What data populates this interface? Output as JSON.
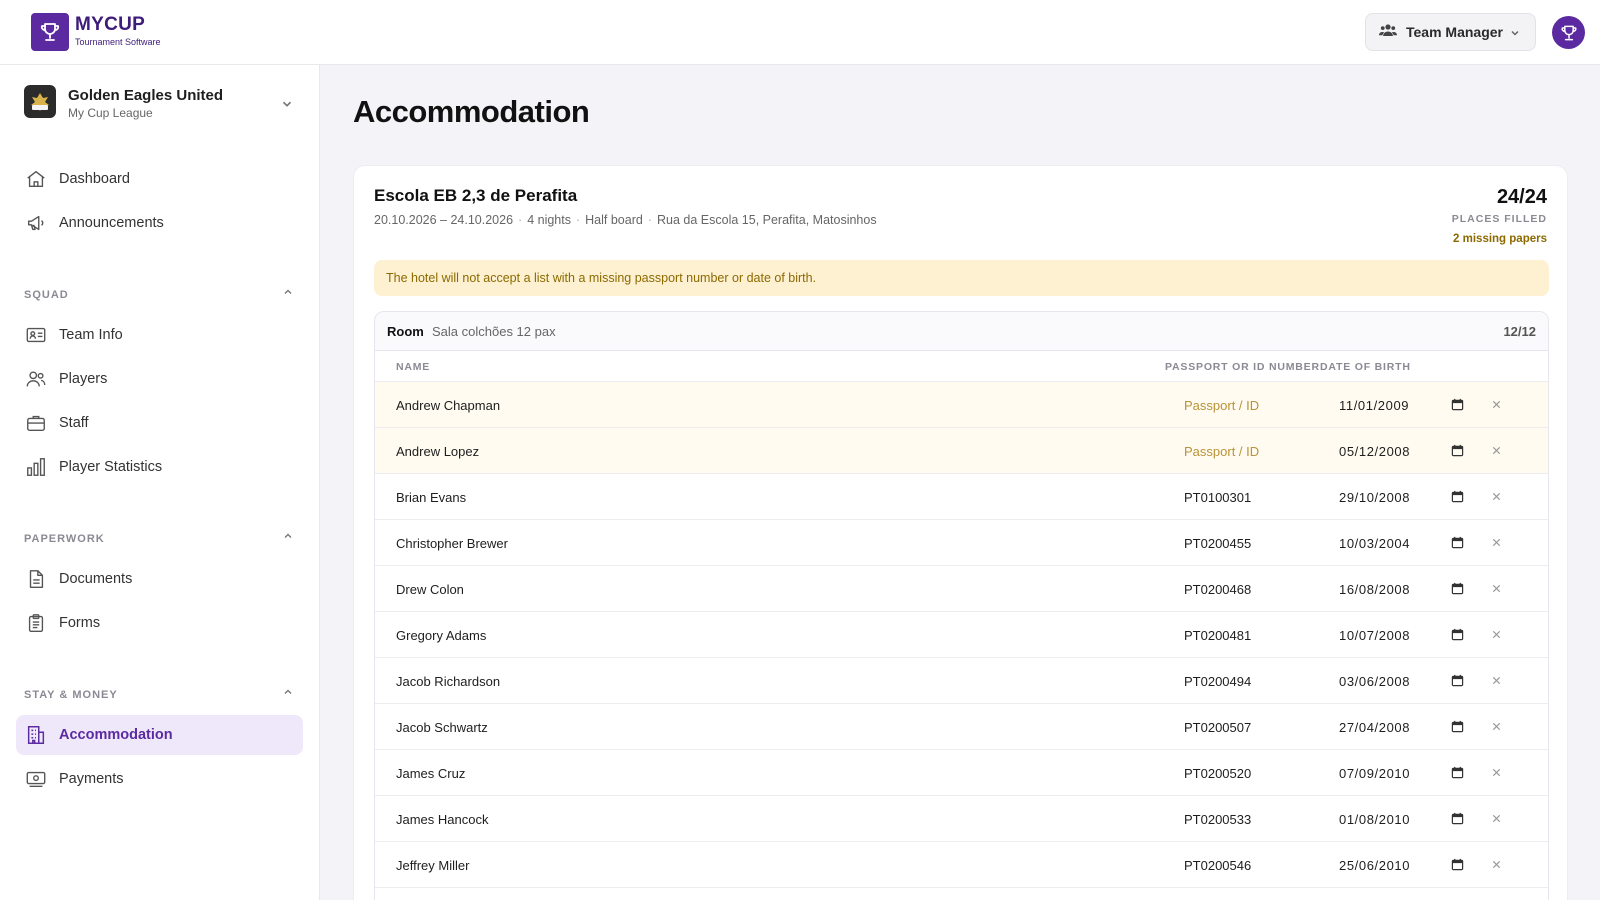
{
  "app": {
    "name": "MYCUP",
    "tagline": "Tournament Software",
    "role_label": "Team Manager"
  },
  "team": {
    "name": "Golden Eagles United",
    "league": "My Cup League"
  },
  "nav": {
    "dashboard": "Dashboard",
    "announcements": "Announcements",
    "squad_header": "SQUAD",
    "team_info": "Team Info",
    "players": "Players",
    "staff": "Staff",
    "player_statistics": "Player Statistics",
    "paperwork_header": "PAPERWORK",
    "documents": "Documents",
    "forms": "Forms",
    "stay_header": "STAY & MONEY",
    "accommodation": "Accommodation",
    "payments": "Payments"
  },
  "page": {
    "title": "Accommodation"
  },
  "venue": {
    "name": "Escola EB 2,3 de Perafita",
    "dates": "20.10.2026 – 24.10.2026",
    "nights": "4 nights",
    "board": "Half board",
    "address": "Rua da Escola 15, Perafita, Matosinhos",
    "filled": "24/24",
    "filled_label": "PLACES FILLED",
    "missing": "2 missing papers",
    "warning": "The hotel will not accept a list with a missing passport number or date of birth."
  },
  "room": {
    "label": "Room",
    "name": "Sala colchões 12 pax",
    "count": "12/12",
    "col_name": "NAME",
    "col_passport": "PASSPORT OR ID NUMBER",
    "col_dob": "DATE OF BIRTH",
    "rows": [
      {
        "name": "Andrew Chapman",
        "passport": "Passport / ID",
        "dob": "11/01/2009"
      },
      {
        "name": "Andrew Lopez",
        "passport": "Passport / ID",
        "dob": "05/12/2008"
      },
      {
        "name": "Brian Evans",
        "passport": "PT0100301",
        "dob": "29/10/2008"
      },
      {
        "name": "Christopher Brewer",
        "passport": "PT0200455",
        "dob": "10/03/2004"
      },
      {
        "name": "Drew Colon",
        "passport": "PT0200468",
        "dob": "16/08/2008"
      },
      {
        "name": "Gregory Adams",
        "passport": "PT0200481",
        "dob": "10/07/2008"
      },
      {
        "name": "Jacob Richardson",
        "passport": "PT0200494",
        "dob": "03/06/2008"
      },
      {
        "name": "Jacob Schwartz",
        "passport": "PT0200507",
        "dob": "27/04/2008"
      },
      {
        "name": "James Cruz",
        "passport": "PT0200520",
        "dob": "07/09/2010"
      },
      {
        "name": "James Hancock",
        "passport": "PT0200533",
        "dob": "01/08/2010"
      },
      {
        "name": "Jeffrey Miller",
        "passport": "PT0200546",
        "dob": "25/06/2010"
      }
    ]
  },
  "colors": {
    "brand": "#5b2aa0",
    "warning_bg": "#fdf1d2",
    "warning_text": "#8c6a00"
  }
}
